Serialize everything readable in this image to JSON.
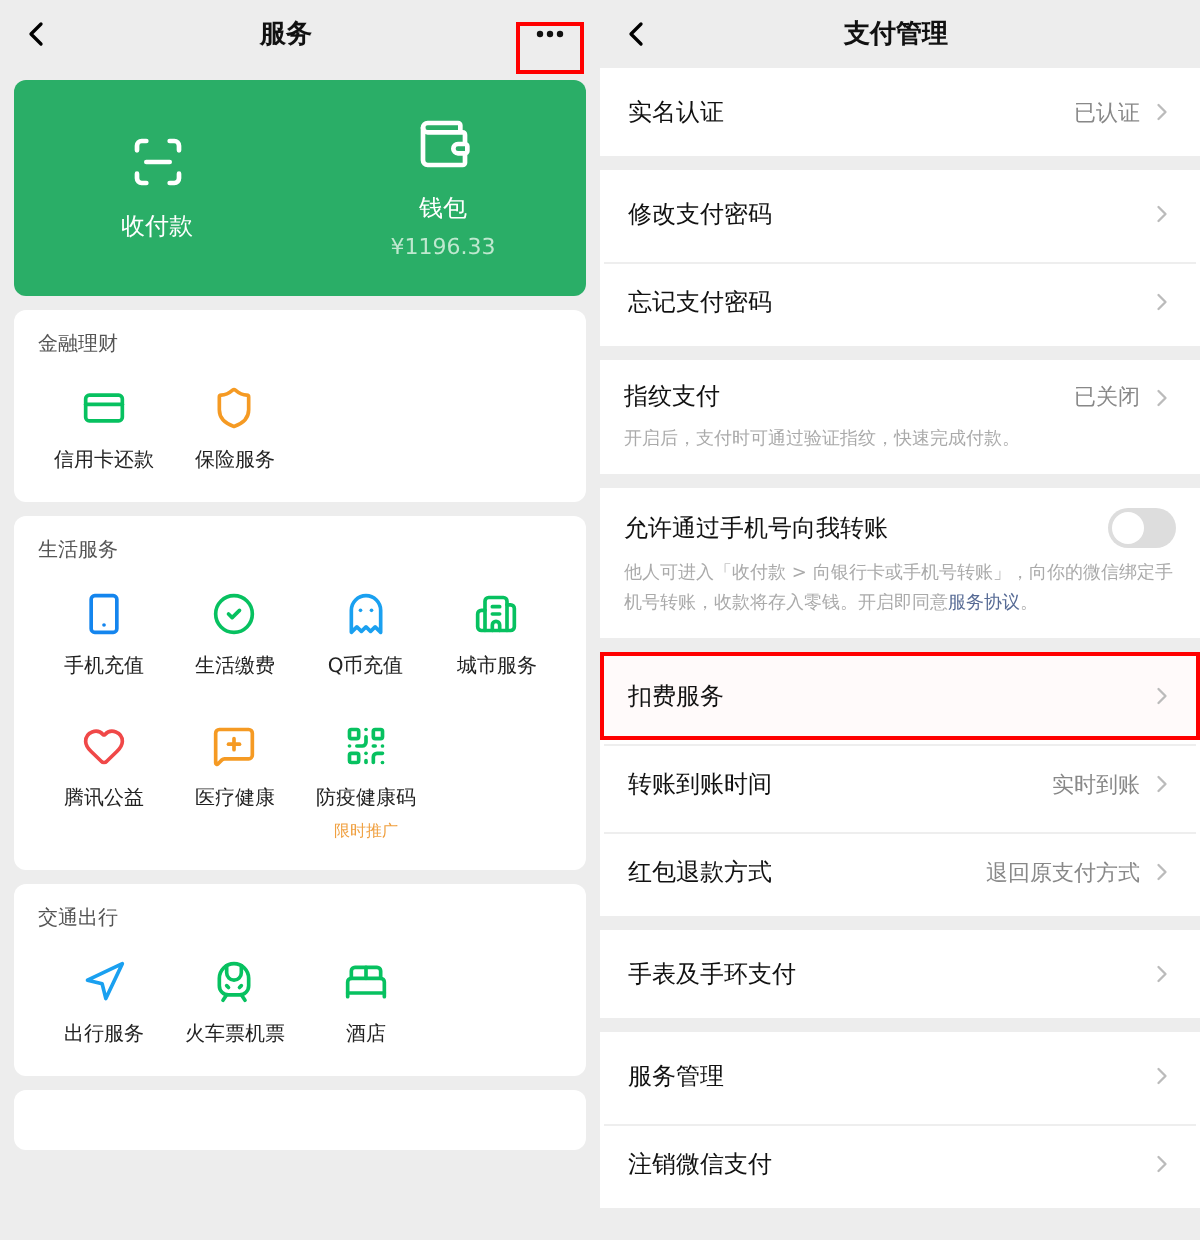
{
  "services_page": {
    "title": "服务",
    "menu_highlighted": true,
    "wallet_card": [
      {
        "label": "收付款"
      },
      {
        "label": "钱包",
        "amount": "¥1196.33"
      }
    ],
    "sections": [
      {
        "title": "金融理财",
        "items": [
          {
            "label": "信用卡还款"
          },
          {
            "label": "保险服务"
          }
        ]
      },
      {
        "title": "生活服务",
        "items": [
          {
            "label": "手机充值"
          },
          {
            "label": "生活缴费"
          },
          {
            "label": "Q币充值"
          },
          {
            "label": "城市服务"
          },
          {
            "label": "腾讯公益"
          },
          {
            "label": "医疗健康"
          },
          {
            "label": "防疫健康码",
            "badge": "限时推广"
          }
        ]
      },
      {
        "title": "交通出行",
        "items": [
          {
            "label": "出行服务"
          },
          {
            "label": "火车票机票"
          },
          {
            "label": "酒店"
          }
        ]
      }
    ]
  },
  "payment_page": {
    "title": "支付管理",
    "groups": [
      [
        {
          "kind": "row",
          "label": "实名认证",
          "value": "已认证",
          "highlighted": false
        }
      ],
      [
        {
          "kind": "row",
          "label": "修改支付密码",
          "highlighted": false
        },
        {
          "kind": "row",
          "label": "忘记支付密码",
          "highlighted": false
        }
      ],
      [
        {
          "kind": "row",
          "label": "指纹支付",
          "value": "已关闭",
          "description": "开启后，支付时可通过验证指纹，快速完成付款。",
          "highlighted": false
        }
      ],
      [
        {
          "kind": "toggle",
          "label": "允许通过手机号向我转账",
          "on": false,
          "description": "他人可进入「收付款 > 向银行卡或手机号转账」，向你的微信绑定手机号转账，收款将存入零钱。开启即同意",
          "link": "服务协议",
          "description_end": "。"
        }
      ],
      [
        {
          "kind": "row",
          "label": "扣费服务",
          "highlighted": true
        },
        {
          "kind": "row",
          "label": "转账到账时间",
          "value": "实时到账",
          "highlighted": false
        },
        {
          "kind": "row",
          "label": "红包退款方式",
          "value": "退回原支付方式",
          "highlighted": false
        }
      ],
      [
        {
          "kind": "row",
          "label": "手表及手环支付",
          "highlighted": false
        }
      ],
      [
        {
          "kind": "row",
          "label": "服务管理",
          "highlighted": false
        },
        {
          "kind": "row",
          "label": "注销微信支付",
          "highlighted": false
        }
      ]
    ]
  }
}
